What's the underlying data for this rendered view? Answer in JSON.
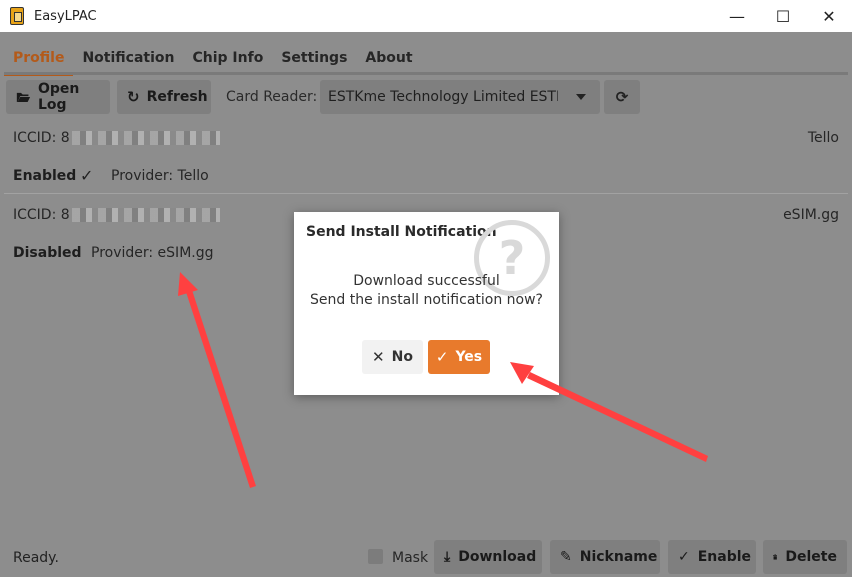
{
  "window": {
    "title": "EasyLPAC",
    "minimize_glyph": "—",
    "maximize_glyph": "☐",
    "close_glyph": "✕"
  },
  "tabs": [
    {
      "label": "Profile",
      "active": true
    },
    {
      "label": "Notification",
      "active": false
    },
    {
      "label": "Chip Info",
      "active": false
    },
    {
      "label": "Settings",
      "active": false
    },
    {
      "label": "About",
      "active": false
    }
  ],
  "toolbar": {
    "open_log_label": "Open Log",
    "refresh_label": "Refresh",
    "card_reader_label": "Card Reader:",
    "card_reader_value": "ESTKme Technology Limited ESTK..."
  },
  "profiles": [
    {
      "iccid_prefix": "ICCID: 8",
      "name": "Tello",
      "state": "Enabled",
      "provider": "Provider: Tello",
      "check": "✓"
    },
    {
      "iccid_prefix": "ICCID: 8",
      "name": "eSIM.gg",
      "state": "Disabled",
      "provider": "Provider: eSIM.gg"
    }
  ],
  "statusbar": {
    "status": "Ready.",
    "mask_label": "Mask",
    "download_label": "Download",
    "nickname_label": "Nickname",
    "enable_label": "Enable",
    "delete_label": "Delete"
  },
  "dialog": {
    "title": "Send Install Notification",
    "message_line1": "Download successful",
    "message_line2": "Send the install notification now?",
    "no_label": "No",
    "yes_label": "Yes"
  },
  "colors": {
    "accent": "#b35a1a",
    "yes_button": "#e87a2c",
    "annotation_arrow": "#ff4040"
  },
  "icons": {
    "open_log": "folder-open-icon",
    "refresh": "refresh-icon",
    "scan": "scan-refresh-icon",
    "download": "download-icon",
    "nickname": "pencil-icon",
    "enable": "check-icon",
    "delete": "trash-icon",
    "dialog": "question-mark-icon"
  }
}
